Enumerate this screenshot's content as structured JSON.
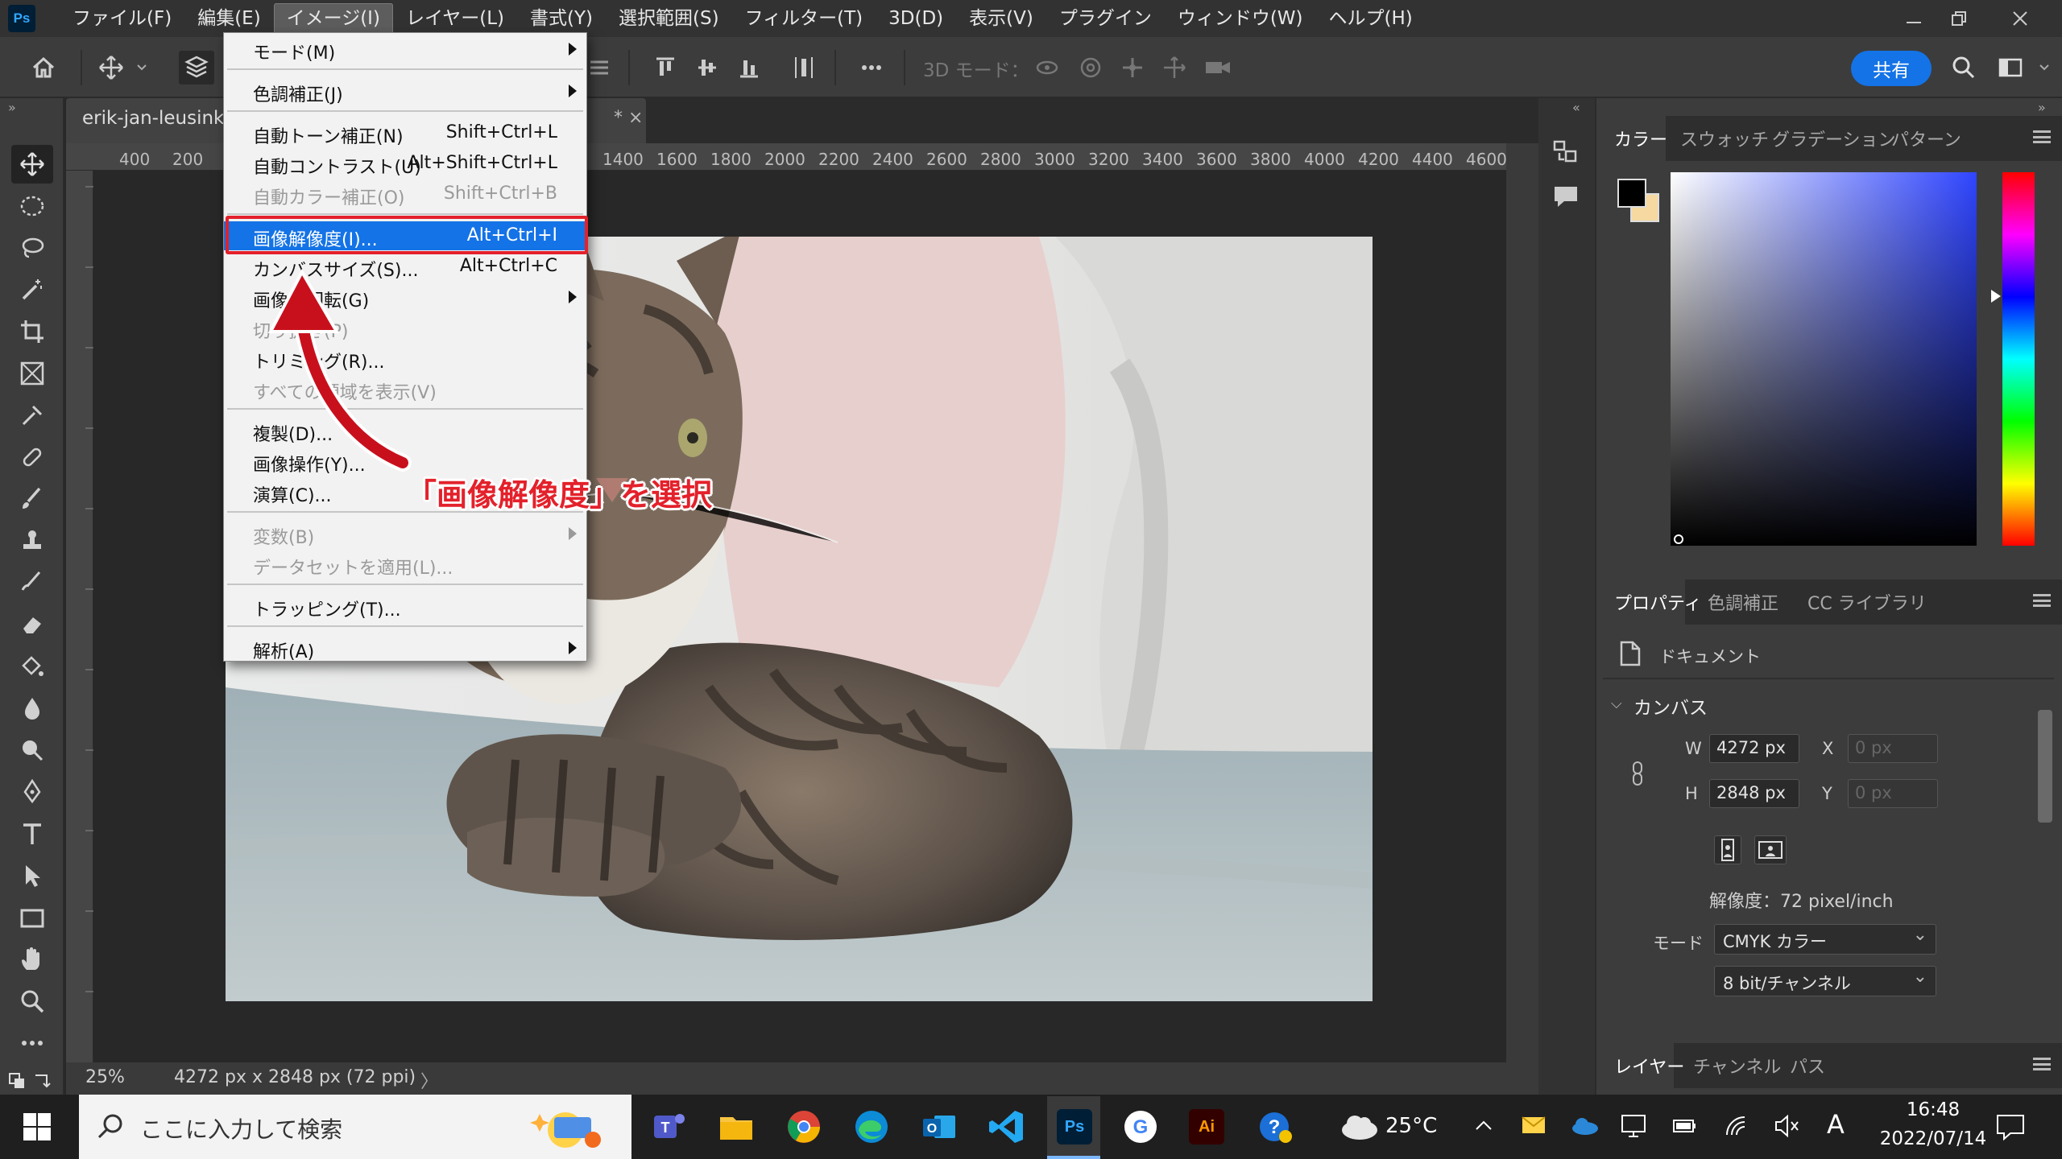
{
  "app": {
    "logo": "Ps"
  },
  "menubar": {
    "items": [
      "ファイル(F)",
      "編集(E)",
      "イメージ(I)",
      "レイヤー(L)",
      "書式(Y)",
      "選択範囲(S)",
      "フィルター(T)",
      "3D(D)",
      "表示(V)",
      "プラグイン",
      "ウィンドウ(W)",
      "ヘルプ(H)"
    ],
    "active_index": 2
  },
  "optionsbar": {
    "mode3d_label": "3D モード：",
    "share_label": "共有"
  },
  "document": {
    "tab_title": "erik-jan-leusink-",
    "tab_suffix": "* ×",
    "ruler_ticks": [
      "400",
      "200",
      "1400",
      "1600",
      "1800",
      "2000",
      "2200",
      "2400",
      "2600",
      "2800",
      "3000",
      "3200",
      "3400",
      "3600",
      "3800",
      "4000",
      "4200",
      "4400",
      "4600"
    ],
    "zoom": "25%",
    "status_info": "4272 px x 2848 px (72 ppi)",
    "status_arrow": "〉"
  },
  "image_menu": {
    "items": [
      {
        "label": "モード(M)",
        "shortcut": "",
        "disabled": false,
        "submenu": true
      },
      {
        "label": "色調補正(J)",
        "shortcut": "",
        "disabled": false,
        "submenu": true
      },
      {
        "label": "自動トーン補正(N)",
        "shortcut": "Shift+Ctrl+L",
        "disabled": false,
        "submenu": false
      },
      {
        "label": "自動コントラスト(U)",
        "shortcut": "Alt+Shift+Ctrl+L",
        "disabled": false,
        "submenu": false
      },
      {
        "label": "自動カラー補正(O)",
        "shortcut": "Shift+Ctrl+B",
        "disabled": true,
        "submenu": false
      },
      {
        "label": "画像解像度(I)...",
        "shortcut": "Alt+Ctrl+I",
        "disabled": false,
        "submenu": false,
        "highlighted": true
      },
      {
        "label": "カンバスサイズ(S)...",
        "shortcut": "Alt+Ctrl+C",
        "disabled": false,
        "submenu": false
      },
      {
        "label": "画像の回転(G)",
        "shortcut": "",
        "disabled": false,
        "submenu": true
      },
      {
        "label": "切り抜き(P)",
        "shortcut": "",
        "disabled": true,
        "submenu": false
      },
      {
        "label": "トリミング(R)...",
        "shortcut": "",
        "disabled": false,
        "submenu": false
      },
      {
        "label": "すべての領域を表示(V)",
        "shortcut": "",
        "disabled": true,
        "submenu": false
      },
      {
        "label": "複製(D)...",
        "shortcut": "",
        "disabled": false,
        "submenu": false
      },
      {
        "label": "画像操作(Y)...",
        "shortcut": "",
        "disabled": false,
        "submenu": false
      },
      {
        "label": "演算(C)...",
        "shortcut": "",
        "disabled": false,
        "submenu": false
      },
      {
        "label": "変数(B)",
        "shortcut": "",
        "disabled": true,
        "submenu": true
      },
      {
        "label": "データセットを適用(L)...",
        "shortcut": "",
        "disabled": true,
        "submenu": false
      },
      {
        "label": "トラッピング(T)...",
        "shortcut": "",
        "disabled": false,
        "submenu": false
      },
      {
        "label": "解析(A)",
        "shortcut": "",
        "disabled": false,
        "submenu": true
      }
    ]
  },
  "annotation": {
    "text": "「画像解像度」を選択",
    "color": "#e3212b"
  },
  "color_panel": {
    "tabs": [
      "カラー",
      "スウォッチ",
      "グラデーション",
      "パターン"
    ],
    "active_tab": 0,
    "foreground": "#000000",
    "background": "#f5d9a0"
  },
  "properties_panel": {
    "tabs": [
      "プロパティ",
      "色調補正",
      "CC ライブラリ"
    ],
    "active_tab": 0,
    "doc_label": "ドキュメント",
    "section_label": "カンバス",
    "w_label": "W",
    "w_value": "4272 px",
    "h_label": "H",
    "h_value": "2848 px",
    "x_label": "X",
    "x_placeholder": "0 px",
    "y_label": "Y",
    "y_placeholder": "0 px",
    "resolution": "解像度：72 pixel/inch",
    "mode_label": "モード",
    "mode_value": "CMYK カラー",
    "depth_value": "8 bit/チャンネル"
  },
  "layers_panel": {
    "tabs": [
      "レイヤー",
      "チャンネル",
      "パス"
    ],
    "active_tab": 0
  },
  "taskbar": {
    "search_placeholder": "ここに入力して検索",
    "apps": [
      "teams-icon",
      "file-explorer-icon",
      "chrome-icon",
      "edge-icon",
      "outlook-icon",
      "vscode-icon",
      "photoshop-icon",
      "google-icon",
      "illustrator-icon",
      "help-icon"
    ],
    "ps_label": "Ps",
    "ai_label": "Ai",
    "temperature": "25°C",
    "ime_label": "A",
    "time": "16:48",
    "date": "2022/07/14"
  }
}
